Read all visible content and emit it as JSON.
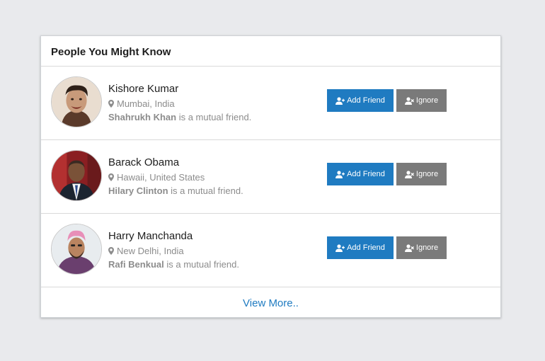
{
  "card": {
    "title": "People You Might Know"
  },
  "people": [
    {
      "name": "Kishore Kumar",
      "location": "Mumbai, India",
      "mutual_name": "Shahrukh Khan",
      "mutual_suffix": " is a mutual friend.",
      "add_label": "Add Friend",
      "ignore_label": "Ignore"
    },
    {
      "name": "Barack Obama",
      "location": "Hawaii, United States",
      "mutual_name": "Hilary Clinton",
      "mutual_suffix": " is a mutual friend.",
      "add_label": "Add Friend",
      "ignore_label": "Ignore"
    },
    {
      "name": "Harry Manchanda",
      "location": "New Delhi, India",
      "mutual_name": "Rafi Benkual",
      "mutual_suffix": " is a mutual friend.",
      "add_label": "Add Friend",
      "ignore_label": "Ignore"
    }
  ],
  "footer": {
    "view_more": "View More.."
  },
  "colors": {
    "primary": "#1f7bc1",
    "ignore": "#7a7a7a",
    "muted": "#8c8c8c",
    "background": "#e9eaed"
  },
  "icons": {
    "location": "map-marker-icon",
    "add": "user-plus-icon",
    "ignore": "user-times-icon"
  }
}
